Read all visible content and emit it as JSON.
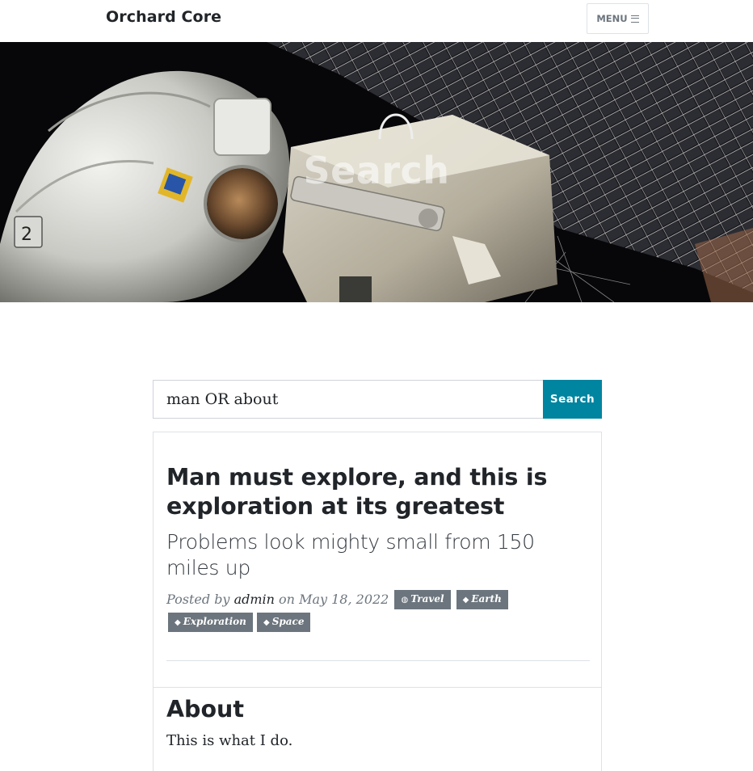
{
  "navbar": {
    "brand": "Orchard Core",
    "menu_label": "MENU",
    "menu_icon": "hamburger-icon"
  },
  "hero": {
    "title": "Search"
  },
  "search": {
    "query": "man OR about",
    "button_label": "Search"
  },
  "results": [
    {
      "title": "Man must explore, and this is exploration at its greatest",
      "subtitle": "Problems look mighty small from 150 miles up",
      "meta_prefix": "Posted by",
      "author": "admin",
      "date_prefix": "on",
      "date": "May 18, 2022",
      "tags": [
        {
          "label": "Travel",
          "icon": "globe-icon"
        },
        {
          "label": "Earth",
          "icon": "tag-icon"
        },
        {
          "label": "Exploration",
          "icon": "tag-icon"
        },
        {
          "label": "Space",
          "icon": "tag-icon"
        }
      ]
    },
    {
      "title": "About",
      "text": "This is what I do."
    }
  ],
  "colors": {
    "accent": "#0085a1",
    "tag_bg": "#6c757d",
    "text": "#212529"
  }
}
